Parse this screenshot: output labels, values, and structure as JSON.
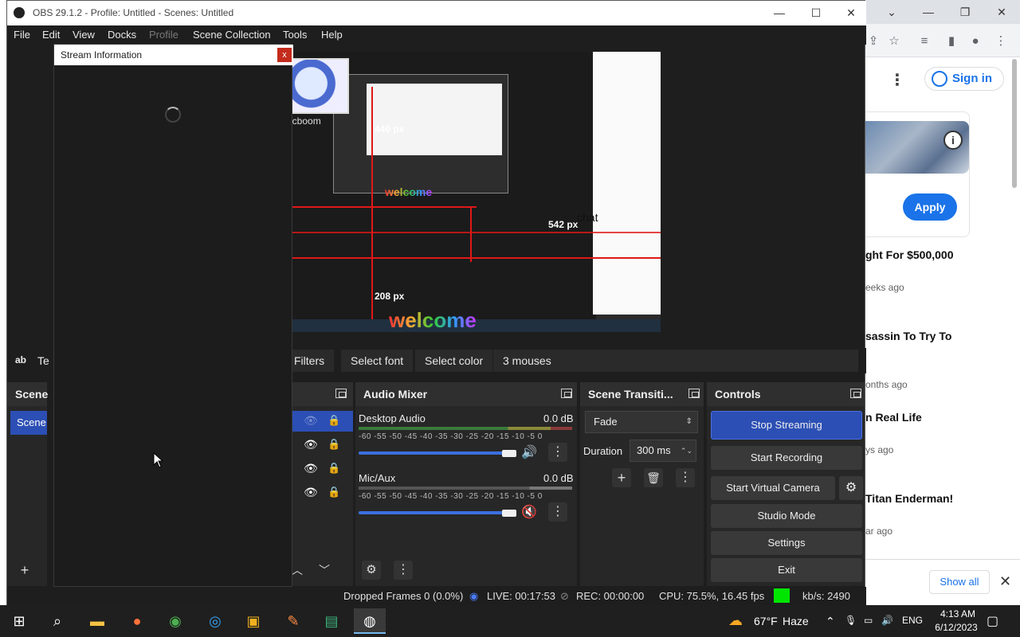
{
  "obs": {
    "window_title": "OBS 29.1.2 - Profile: Untitled - Scenes: Untitled",
    "menu": [
      "File",
      "Edit",
      "View",
      "Docks",
      "Profile",
      "Scene Collection",
      "Tools",
      "Help"
    ],
    "source_toolbar": {
      "source_name": "Te",
      "filters": "Filters",
      "select_font": "Select font",
      "select_color": "Select color",
      "text_value": "3 mouses"
    },
    "scenes": {
      "title": "Scene",
      "selected": "Scene"
    },
    "audio_mixer": {
      "title": "Audio Mixer",
      "channels": [
        {
          "name": "Desktop Audio",
          "level": "0.0 dB",
          "ticks": "-60 -55 -50 -45 -40 -35 -30 -25 -20 -15 -10 -5 0",
          "muted": false,
          "volume_fraction": 0.92
        },
        {
          "name": "Mic/Aux",
          "level": "0.0 dB",
          "ticks": "-60 -55 -50 -45 -40 -35 -30 -25 -20 -15 -10 -5 0",
          "muted": true,
          "volume_fraction": 0.92
        }
      ]
    },
    "scene_transitions": {
      "title": "Scene Transiti...",
      "transition": "Fade",
      "duration_label": "Duration",
      "duration_value": "300 ms"
    },
    "controls": {
      "title": "Controls",
      "stop_streaming": "Stop Streaming",
      "start_recording": "Start Recording",
      "start_virtual_camera": "Start Virtual Camera",
      "studio_mode": "Studio Mode",
      "settings": "Settings",
      "exit": "Exit"
    },
    "status": {
      "dropped_frames": "Dropped Frames 0 (0.0%)",
      "live": "LIVE: 00:17:53",
      "rec": "REC: 00:00:00",
      "cpu": "CPU: 75.5%, 16.45 fps",
      "kbs": "kb/s: 2490",
      "accent_color": "#00e600"
    },
    "preview": {
      "label_440": "440 px",
      "label_208": "208 px",
      "label_542": "542 px",
      "label_boom": "acboom",
      "label_chat": "chat",
      "welcome": "welcome",
      "welcome_small": "welcome"
    }
  },
  "dialog": {
    "title": "Stream Information",
    "close": "x"
  },
  "browser": {
    "sign_in": "Sign in",
    "apply": "Apply",
    "items": [
      {
        "title": "ght For $500,000",
        "meta": "eeks ago"
      },
      {
        "title": "sassin To Try To",
        "meta": "onths ago"
      },
      {
        "title": "n Real Life",
        "meta": "ys ago"
      },
      {
        "title": "Titan Enderman!",
        "meta": "ar ago"
      }
    ],
    "show_all": "Show all"
  },
  "taskbar": {
    "weather_temp": "67°F",
    "weather_desc": "Haze",
    "lang": "ENG",
    "time": "4:13 AM",
    "date": "6/12/2023"
  }
}
